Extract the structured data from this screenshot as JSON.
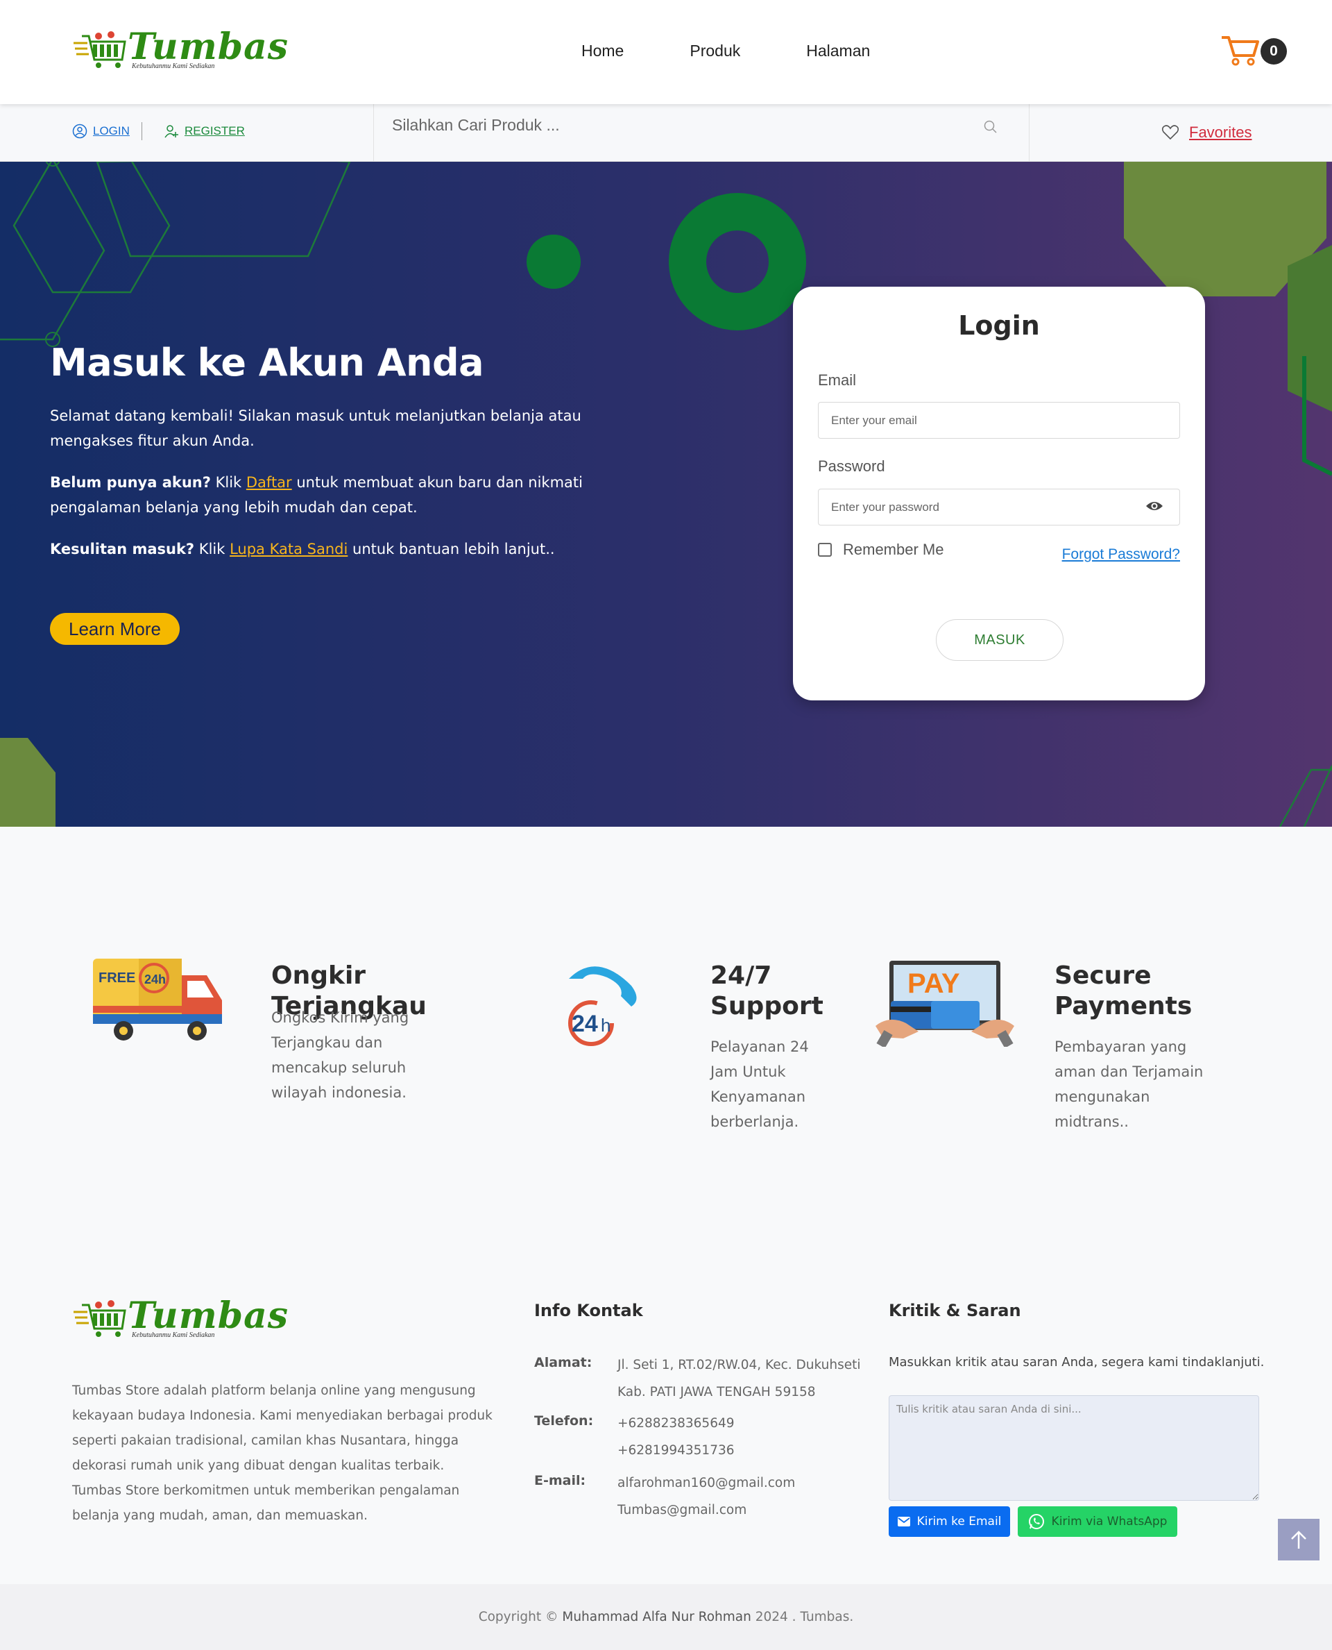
{
  "header": {
    "logo": {
      "brand": "Tumbas",
      "tagline": "Kebutuhanmu Kami Sediakan"
    },
    "nav": [
      {
        "label": "Home"
      },
      {
        "label": "Produk"
      },
      {
        "label": "Halaman"
      }
    ],
    "cart_count": "0"
  },
  "subbar": {
    "login_label": "LOGIN",
    "register_label": "REGISTER",
    "search_placeholder": "Silahkan Cari Produk ...",
    "favorites_label": "Favorites"
  },
  "hero": {
    "title": "Masuk ke Akun Anda",
    "paragraph1": "Selamat datang kembali! Silakan masuk untuk melanjutkan belanja atau mengakses fitur akun Anda.",
    "p2_bold": "Belum punya akun?",
    "p2_pre": " Klik ",
    "p2_link": "Daftar",
    "p2_post": " untuk membuat akun baru dan nikmati pengalaman belanja yang lebih mudah dan cepat.",
    "p3_bold": "Kesulitan masuk?",
    "p3_pre": " Klik ",
    "p3_link": "Lupa Kata Sandi",
    "p3_post": " untuk bantuan lebih lanjut..",
    "learn_more": "Learn More"
  },
  "login": {
    "title": "Login",
    "email_label": "Email",
    "email_placeholder": "Enter your email",
    "password_label": "Password",
    "password_placeholder": "Enter your password",
    "remember_label": "Remember Me",
    "forgot_label": "Forgot Password?",
    "submit_label": "MASUK"
  },
  "features": [
    {
      "title": "Ongkir Terjangkau",
      "text": "Ongkos Kirim yang Terjangkau dan mencakup seluruh wilayah indonesia.",
      "icon": "delivery-truck-icon"
    },
    {
      "title": "24/7 Support",
      "text": "Pelayanan 24 Jam Untuk Kenyamanan berberlanja.",
      "icon": "support-24h-icon"
    },
    {
      "title": "Secure Payments",
      "text": "Pembayaran yang aman dan Terjamain mengunakan midtrans..",
      "icon": "secure-payment-icon"
    }
  ],
  "footer": {
    "about": "Tumbas Store adalah platform belanja online yang mengusung kekayaan budaya Indonesia. Kami menyediakan berbagai produk seperti pakaian tradisional, camilan khas Nusantara, hingga dekorasi rumah unik yang dibuat dengan kualitas terbaik. Tumbas Store berkomitmen untuk memberikan pengalaman belanja yang mudah, aman, dan memuaskan.",
    "contact_heading": "Info Kontak",
    "address_label": "Alamat:",
    "address_line1": "Jl. Seti 1, RT.02/RW.04, Kec. Dukuhseti",
    "address_line2": "Kab. PATI JAWA TENGAH 59158",
    "phone_label": "Telefon:",
    "phone1": "+6288238365649",
    "phone2": "+6281994351736",
    "email_label": "E-mail:",
    "email1": "alfarohman160@gmail.com",
    "email2": "Tumbas@gmail.com",
    "kritik_heading": "Kritik & Saran",
    "kritik_desc": "Masukkan kritik atau saran Anda, segera kami tindaklanjuti.",
    "kritik_placeholder": "Tulis kritik atau saran Anda di sini...",
    "send_email_label": "Kirim ke Email",
    "send_wa_label": "Kirim via WhatsApp"
  },
  "copyright": {
    "prefix": "Copyright © ",
    "name": "Muhammad Alfa Nur Rohman",
    "suffix": " 2024 . Tumbas."
  },
  "colors": {
    "accent_green": "#2e8b14",
    "hero_start": "#142d66",
    "hero_end": "#53356e",
    "learn_more_yellow": "#f5b800",
    "link_blue": "#1a7bd6",
    "favorites_red": "#d12c3d"
  }
}
